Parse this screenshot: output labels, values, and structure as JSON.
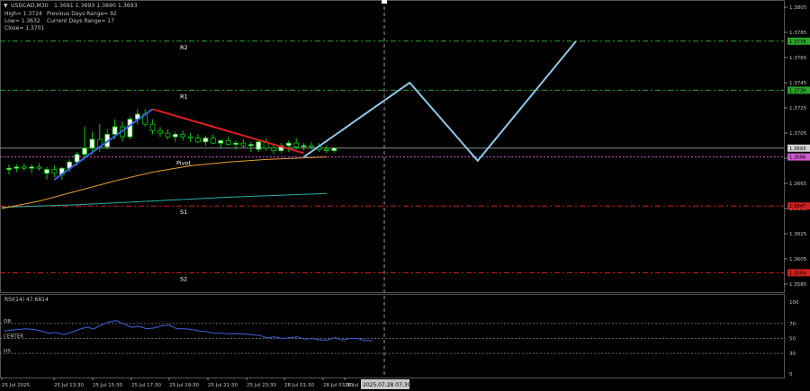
{
  "header": {
    "symbol": "USDCAD,M30",
    "ohlc": "1.3691 1.3693 1.3690 1.3693",
    "high": "High= 1.3724",
    "low": "Low= 1.3632",
    "close": "Close= 1.3701",
    "prev_range": "Previous Days Range= 92",
    "cur_range": "Current Days Range= 17"
  },
  "levels": [
    {
      "name": "R2",
      "value": 1.3778,
      "price_label": "1.3778",
      "color": "#2aa52a"
    },
    {
      "name": "R1",
      "value": 1.3739,
      "price_label": "1.3739",
      "color": "#2aa52a"
    },
    {
      "name": "Pivot",
      "value": 1.3686,
      "price_label": "1.3686",
      "color": "#d05ad0"
    },
    {
      "name": "S1",
      "value": 1.3647,
      "price_label": "1.3647",
      "color": "#d22020"
    },
    {
      "name": "S2",
      "value": 1.3594,
      "price_label": "1.3594",
      "color": "#d22020"
    }
  ],
  "current_price": {
    "value": 1.3693,
    "label": "1.3693"
  },
  "price_axis_ticks": [
    "1.3805",
    "1.3785",
    "1.3765",
    "1.3745",
    "1.3725",
    "1.3705",
    "1.3685",
    "1.3665",
    "1.3645",
    "1.3625",
    "1.3605",
    "1.3585"
  ],
  "rsi": {
    "title": "RSI(14) 47.6814",
    "levels": [
      {
        "label": "OB",
        "value": 70
      },
      {
        "label": "CENTER",
        "value": 50
      },
      {
        "label": "OS",
        "value": 30
      }
    ],
    "axis_ticks": [
      "100",
      "70",
      "50",
      "30",
      "0"
    ]
  },
  "time_axis": {
    "labels": [
      "25 Jul 2025",
      "25 Jul 13:30",
      "25 Jul 15:30",
      "25 Jul 17:30",
      "25 Jul 19:30",
      "25 Jul 21:30",
      "25 Jul 23:30",
      "28 Jul 01:30",
      "28 Jul 03:30",
      "28 Jul"
    ],
    "cursor_label": "2025.07.28 07:30"
  },
  "colors": {
    "background": "#000000",
    "bull_candle": "#ffffff",
    "bear_candle": "#000000",
    "candle_wick": "#00c800",
    "ma_slow": "#2ab0a8",
    "ma_fast": "#e8a030",
    "trend_up": "#3c64dc",
    "trend_down": "#e02020",
    "forecast": "#90c8e8",
    "rsi_line": "#3c64dc"
  },
  "chart_data": {
    "type": "candlestick",
    "ylim": [
      1.3575,
      1.3815
    ],
    "candles": [
      {
        "t": "25 Jul 09:00",
        "o": 1.3676,
        "h": 1.368,
        "l": 1.3672,
        "c": 1.3677
      },
      {
        "t": "25 Jul 09:30",
        "o": 1.3677,
        "h": 1.368,
        "l": 1.3674,
        "c": 1.3678
      },
      {
        "t": "25 Jul 10:00",
        "o": 1.3678,
        "h": 1.3681,
        "l": 1.3675,
        "c": 1.3677
      },
      {
        "t": "25 Jul 10:30",
        "o": 1.3677,
        "h": 1.368,
        "l": 1.3673,
        "c": 1.3678
      },
      {
        "t": "25 Jul 11:00",
        "o": 1.3678,
        "h": 1.3681,
        "l": 1.3675,
        "c": 1.3677
      },
      {
        "t": "25 Jul 11:30",
        "o": 1.3673,
        "h": 1.3678,
        "l": 1.3668,
        "c": 1.3676
      },
      {
        "t": "25 Jul 12:00",
        "o": 1.3676,
        "h": 1.3679,
        "l": 1.367,
        "c": 1.3673
      },
      {
        "t": "25 Jul 12:30",
        "o": 1.3672,
        "h": 1.3678,
        "l": 1.3668,
        "c": 1.3677
      },
      {
        "t": "25 Jul 13:00",
        "o": 1.3677,
        "h": 1.3684,
        "l": 1.3674,
        "c": 1.3682
      },
      {
        "t": "25 Jul 13:30",
        "o": 1.3682,
        "h": 1.369,
        "l": 1.3679,
        "c": 1.3688
      },
      {
        "t": "25 Jul 14:00",
        "o": 1.3688,
        "h": 1.371,
        "l": 1.3684,
        "c": 1.3693
      },
      {
        "t": "25 Jul 14:30",
        "o": 1.3693,
        "h": 1.3706,
        "l": 1.3688,
        "c": 1.37
      },
      {
        "t": "25 Jul 15:00",
        "o": 1.37,
        "h": 1.3712,
        "l": 1.369,
        "c": 1.3694
      },
      {
        "t": "25 Jul 15:30",
        "o": 1.3694,
        "h": 1.3708,
        "l": 1.3692,
        "c": 1.3704
      },
      {
        "t": "25 Jul 16:00",
        "o": 1.3704,
        "h": 1.3716,
        "l": 1.37,
        "c": 1.371
      },
      {
        "t": "25 Jul 16:30",
        "o": 1.371,
        "h": 1.3714,
        "l": 1.3698,
        "c": 1.3702
      },
      {
        "t": "25 Jul 17:00",
        "o": 1.3702,
        "h": 1.3718,
        "l": 1.37,
        "c": 1.3716
      },
      {
        "t": "25 Jul 17:30",
        "o": 1.3716,
        "h": 1.3724,
        "l": 1.3712,
        "c": 1.372
      },
      {
        "t": "25 Jul 18:00",
        "o": 1.372,
        "h": 1.3724,
        "l": 1.371,
        "c": 1.3712
      },
      {
        "t": "25 Jul 18:30",
        "o": 1.3712,
        "h": 1.3716,
        "l": 1.3704,
        "c": 1.3707
      },
      {
        "t": "25 Jul 19:00",
        "o": 1.3707,
        "h": 1.371,
        "l": 1.3702,
        "c": 1.3705
      },
      {
        "t": "25 Jul 19:30",
        "o": 1.3705,
        "h": 1.3708,
        "l": 1.37,
        "c": 1.3702
      },
      {
        "t": "25 Jul 20:00",
        "o": 1.3702,
        "h": 1.3706,
        "l": 1.3698,
        "c": 1.3704
      },
      {
        "t": "25 Jul 20:30",
        "o": 1.3704,
        "h": 1.3707,
        "l": 1.3699,
        "c": 1.3702
      },
      {
        "t": "25 Jul 21:00",
        "o": 1.3702,
        "h": 1.3705,
        "l": 1.3698,
        "c": 1.3701
      },
      {
        "t": "25 Jul 21:30",
        "o": 1.3701,
        "h": 1.3704,
        "l": 1.3697,
        "c": 1.3698
      },
      {
        "t": "25 Jul 22:00",
        "o": 1.3698,
        "h": 1.3703,
        "l": 1.3695,
        "c": 1.3701
      },
      {
        "t": "25 Jul 22:30",
        "o": 1.3701,
        "h": 1.3704,
        "l": 1.3696,
        "c": 1.3697
      },
      {
        "t": "25 Jul 23:00",
        "o": 1.3697,
        "h": 1.37,
        "l": 1.3693,
        "c": 1.3699
      },
      {
        "t": "25 Jul 23:30",
        "o": 1.3699,
        "h": 1.3702,
        "l": 1.3695,
        "c": 1.3696
      },
      {
        "t": "28 Jul 00:00",
        "o": 1.3696,
        "h": 1.3699,
        "l": 1.3692,
        "c": 1.3697
      },
      {
        "t": "28 Jul 00:30",
        "o": 1.3697,
        "h": 1.37,
        "l": 1.3693,
        "c": 1.3695
      },
      {
        "t": "28 Jul 01:00",
        "o": 1.3695,
        "h": 1.3698,
        "l": 1.369,
        "c": 1.3696
      },
      {
        "t": "28 Jul 01:30",
        "o": 1.3692,
        "h": 1.3699,
        "l": 1.369,
        "c": 1.3698
      },
      {
        "t": "28 Jul 02:00",
        "o": 1.3698,
        "h": 1.3701,
        "l": 1.3691,
        "c": 1.3693
      },
      {
        "t": "28 Jul 02:30",
        "o": 1.3693,
        "h": 1.3696,
        "l": 1.3688,
        "c": 1.3691
      },
      {
        "t": "28 Jul 03:00",
        "o": 1.3691,
        "h": 1.3697,
        "l": 1.3689,
        "c": 1.3695
      },
      {
        "t": "28 Jul 03:30",
        "o": 1.3695,
        "h": 1.3699,
        "l": 1.369,
        "c": 1.3697
      },
      {
        "t": "28 Jul 04:00",
        "o": 1.3697,
        "h": 1.3701,
        "l": 1.3692,
        "c": 1.3694
      },
      {
        "t": "28 Jul 04:30",
        "o": 1.3694,
        "h": 1.3697,
        "l": 1.3691,
        "c": 1.3695
      },
      {
        "t": "28 Jul 05:00",
        "o": 1.3695,
        "h": 1.3698,
        "l": 1.3692,
        "c": 1.3694
      },
      {
        "t": "28 Jul 05:30",
        "o": 1.3694,
        "h": 1.3697,
        "l": 1.369,
        "c": 1.3692
      },
      {
        "t": "28 Jul 06:00",
        "o": 1.3692,
        "h": 1.3695,
        "l": 1.3689,
        "c": 1.3691
      },
      {
        "t": "28 Jul 06:30",
        "o": 1.3691,
        "h": 1.3694,
        "l": 1.3689,
        "c": 1.3693
      }
    ],
    "ma_slow": [
      [
        0,
        1.3646
      ],
      [
        10,
        1.3648
      ],
      [
        20,
        1.3651
      ],
      [
        30,
        1.3654
      ],
      [
        43,
        1.3657
      ]
    ],
    "ma_fast": [
      [
        0,
        1.3645
      ],
      [
        5,
        1.3651
      ],
      [
        10,
        1.3659
      ],
      [
        15,
        1.3667
      ],
      [
        20,
        1.3674
      ],
      [
        25,
        1.3679
      ],
      [
        30,
        1.3682
      ],
      [
        35,
        1.3684
      ],
      [
        43,
        1.3686
      ]
    ],
    "trend_up": [
      [
        6,
        1.3668
      ],
      [
        19,
        1.3724
      ]
    ],
    "trend_down": [
      [
        19,
        1.3724
      ],
      [
        39,
        1.3689
      ]
    ],
    "forecast": [
      [
        39,
        1.3686
      ],
      [
        53,
        1.3745
      ],
      [
        62,
        1.3683
      ],
      [
        75,
        1.3778
      ]
    ],
    "rsi_values": [
      60,
      61,
      62,
      63,
      62,
      60,
      57,
      58,
      55,
      58,
      62,
      65,
      63,
      68,
      72,
      74,
      69,
      65,
      66,
      63,
      64,
      67,
      68,
      63,
      63,
      62,
      60,
      59,
      57,
      57,
      56,
      56,
      56,
      55,
      54,
      51,
      52,
      50,
      51,
      52,
      49,
      50,
      48,
      48,
      51,
      48,
      50,
      50,
      47,
      47
    ]
  }
}
